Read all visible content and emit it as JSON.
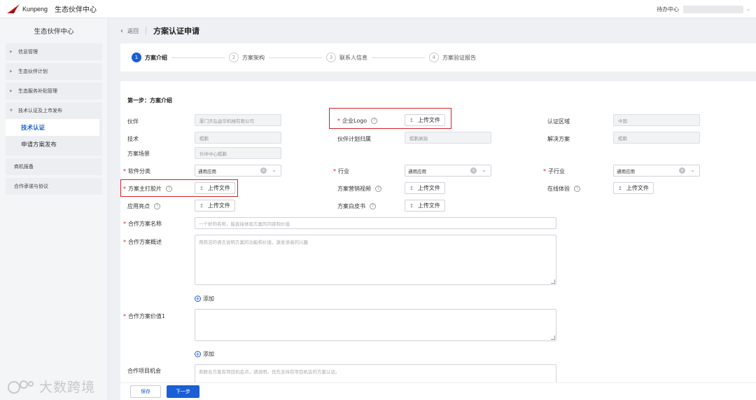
{
  "topbar": {
    "logo_text": "Kunpeng",
    "portal_name": "生态伙伴中心",
    "todo": "待办中心"
  },
  "sidebar": {
    "title": "生态伙伴中心",
    "items": [
      {
        "label": "信息管理"
      },
      {
        "label": "生态伙伴计划"
      },
      {
        "label": "生态服务补贴管理"
      }
    ],
    "group": {
      "label": "技术认证及上市发布",
      "children": [
        {
          "label": "技术认证",
          "active": true
        },
        {
          "label": "申请方案发布"
        }
      ]
    },
    "plain_items": [
      {
        "label": "商机报备"
      },
      {
        "label": "合作承诺与协议"
      }
    ]
  },
  "header": {
    "back_label": "返回",
    "title": "方案认证申请"
  },
  "steps": [
    {
      "num": "1",
      "label": "方案介绍",
      "active": true
    },
    {
      "num": "2",
      "label": "方案架构"
    },
    {
      "num": "3",
      "label": "联系人信息"
    },
    {
      "num": "4",
      "label": "方案验证报告"
    }
  ],
  "form": {
    "section_title": "第一步：方案介绍",
    "partner": {
      "label": "伙伴",
      "value": "厦门天弘益华机械有限公司"
    },
    "tech": {
      "label": "技术",
      "value": "鲲鹏"
    },
    "scene": {
      "label": "方案场景",
      "value": "伙伴中心鲲鹏"
    },
    "logo": {
      "label": "企业Logo"
    },
    "plan": {
      "label": "伙伴计划归属",
      "value": "鲲鹏展翅"
    },
    "region": {
      "label": "认证区域",
      "value": "中国"
    },
    "solution": {
      "label": "解决方案",
      "value": "鲲鹏"
    },
    "software_category": {
      "label": "软件分类",
      "value": "通用应用"
    },
    "industry": {
      "label": "行业",
      "value": "通用应用"
    },
    "sub_industry": {
      "label": "子行业",
      "value": "通用应用"
    },
    "main_slide": {
      "label": "方案主打胶片"
    },
    "marketing_video": {
      "label": "方案营销视频"
    },
    "online_trial": {
      "label": "在线体验"
    },
    "highlights": {
      "label": "应用亮点"
    },
    "whitepaper": {
      "label": "方案白皮书"
    },
    "name": {
      "label": "合作方案名称",
      "placeholder": "一个好的名称，能直接体现方案的内容和价值"
    },
    "overview": {
      "label": "合作方案概述",
      "placeholder": "用简洁的语言说明方案的功能和价值，激发读者的兴趣"
    },
    "value1": {
      "label": "合作方案价值1"
    },
    "opportunity": {
      "label": "合作项目机会",
      "placeholder": "若联合方案有项目机会点，请说明。优先支持有项目机会的方案认证。"
    },
    "upload_label": "上传文件",
    "add_label": "添加"
  },
  "footer": {
    "save": "保存",
    "next": "下一步"
  },
  "watermark": "大数跨境",
  "colors": {
    "primary": "#1a5fd6",
    "highlight": "#d2232a",
    "required": "#e02020"
  }
}
